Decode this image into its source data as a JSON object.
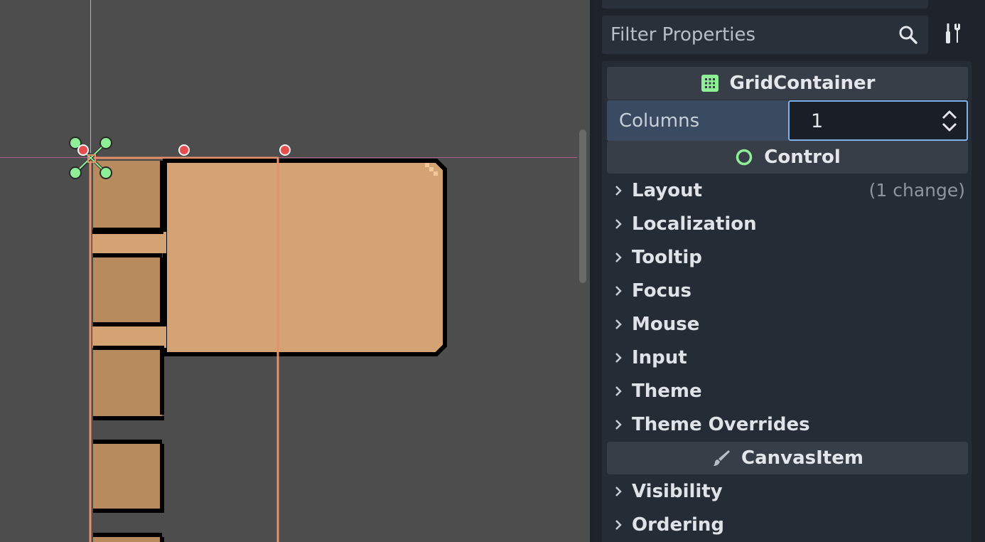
{
  "inspector": {
    "filter_placeholder": "Filter Properties",
    "search_icon": "search-icon",
    "tools_icon": "tools-icon"
  },
  "grid_container": {
    "title": "GridContainer",
    "icon": "grid-icon",
    "icon_color": "#8eef97",
    "property": {
      "label": "Columns",
      "value": "1"
    }
  },
  "control": {
    "title": "Control",
    "icon": "circle-icon",
    "icon_color": "#8eef97",
    "groups": [
      {
        "label": "Layout",
        "note": "(1 change)"
      },
      {
        "label": "Localization",
        "note": ""
      },
      {
        "label": "Tooltip",
        "note": ""
      },
      {
        "label": "Focus",
        "note": ""
      },
      {
        "label": "Mouse",
        "note": ""
      },
      {
        "label": "Input",
        "note": ""
      },
      {
        "label": "Theme",
        "note": ""
      },
      {
        "label": "Theme Overrides",
        "note": ""
      }
    ]
  },
  "canvas_item": {
    "title": "CanvasItem",
    "icon": "brush-icon",
    "groups": [
      {
        "label": "Visibility"
      },
      {
        "label": "Ordering"
      }
    ]
  },
  "colors": {
    "viewport_bg": "#4d4d4d",
    "panel_bg": "#262c35",
    "ui_fill": "#d4a373",
    "ui_dark_fill": "#b88b5e",
    "selection": "#e6906a",
    "handle_green": "#8eef97",
    "handle_red": "#e84d4d",
    "accent_blue": "#7fb0e6"
  }
}
